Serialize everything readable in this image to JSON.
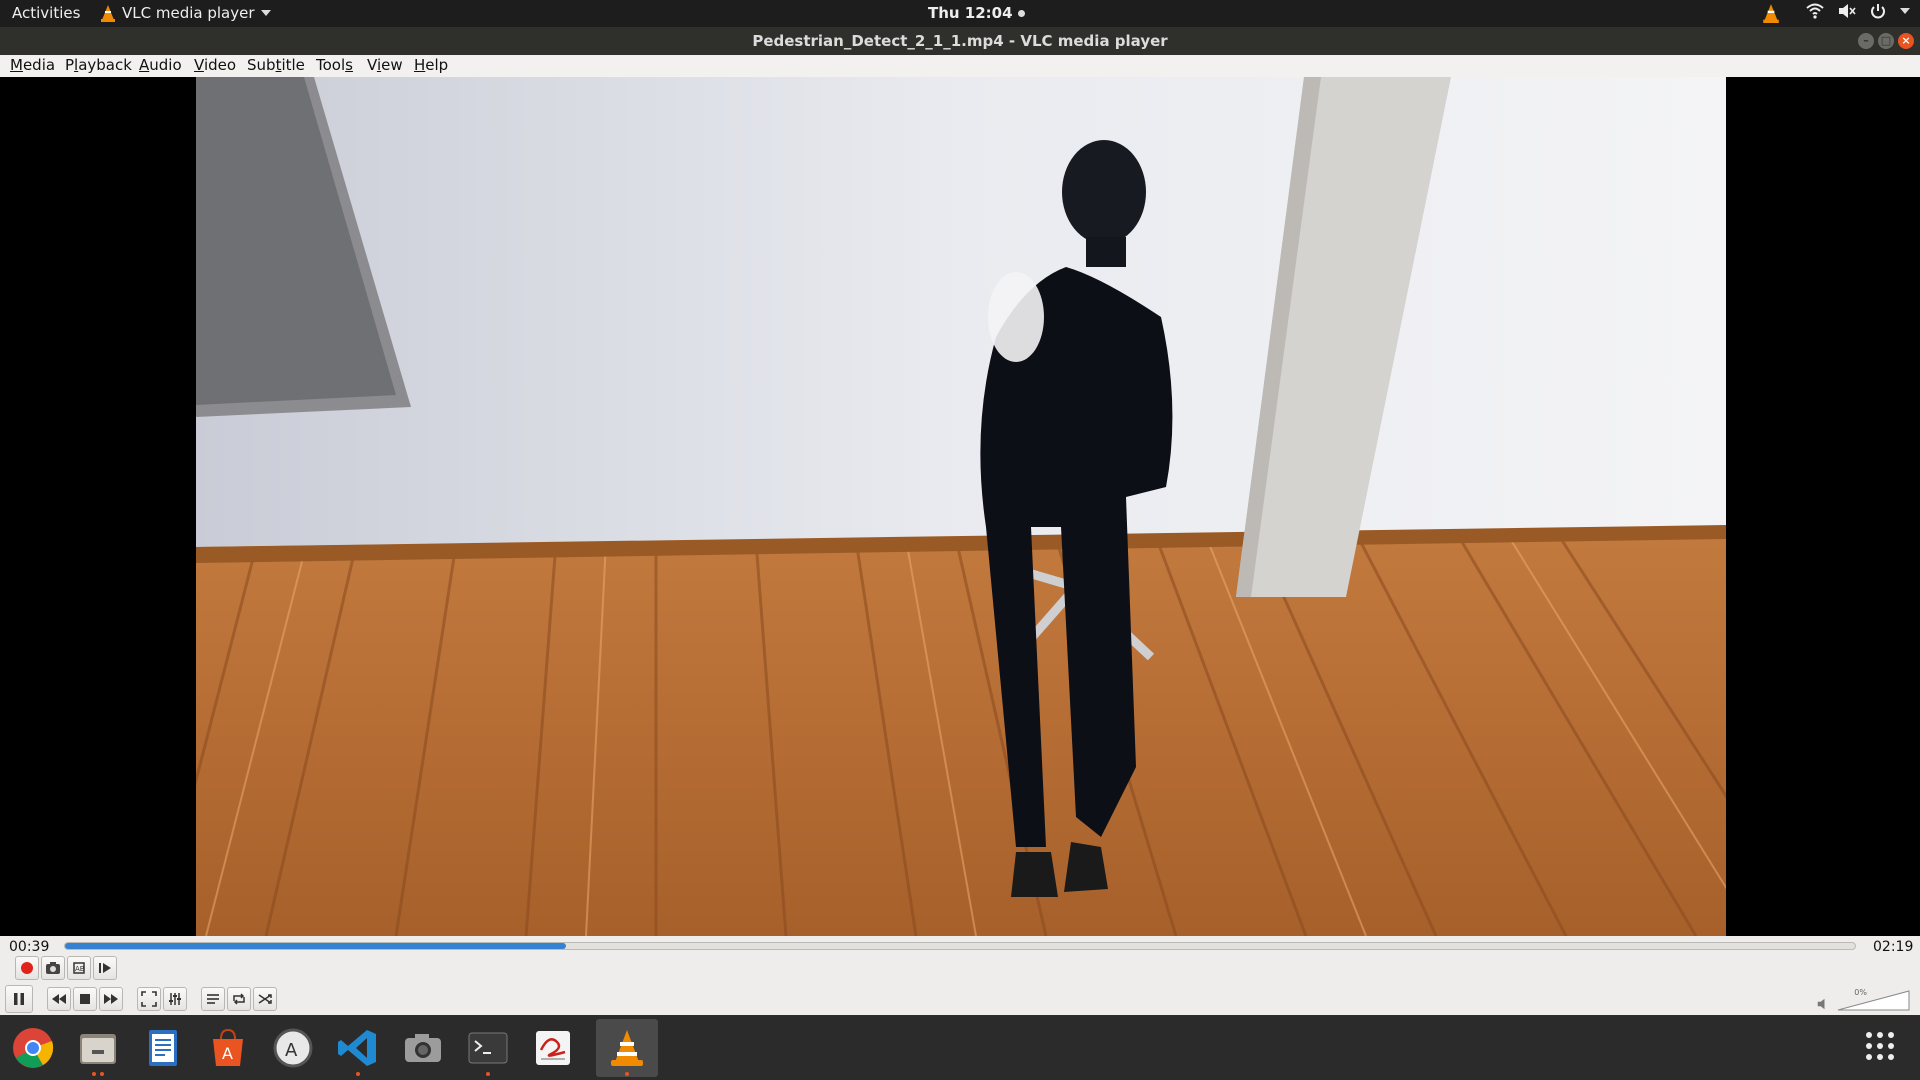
{
  "topbar": {
    "activities": "Activities",
    "app_name": "VLC media player",
    "clock": "Thu 12:04",
    "tray_icons": [
      "vlc-tray-icon",
      "wifi-icon",
      "volume-muted-icon",
      "power-icon"
    ]
  },
  "window": {
    "title": "Pedestrian_Detect_2_1_1.mp4 - VLC media player",
    "buttons": [
      "minimize",
      "maximize",
      "close"
    ]
  },
  "menubar": {
    "items": [
      {
        "label": "Media",
        "mnemonic": "M"
      },
      {
        "label": "Playback",
        "mnemonic": "l"
      },
      {
        "label": "Audio",
        "mnemonic": "A"
      },
      {
        "label": "Video",
        "mnemonic": "V"
      },
      {
        "label": "Subtitle",
        "mnemonic": "t"
      },
      {
        "label": "Tools",
        "mnemonic": "s"
      },
      {
        "label": "View",
        "mnemonic": "i"
      },
      {
        "label": "Help",
        "mnemonic": "H"
      }
    ]
  },
  "player": {
    "elapsed": "00:39",
    "total": "02:19",
    "progress_fraction": 0.28,
    "volume_percent": "0%",
    "colors": {
      "progress": "#3583d0",
      "record": "#e0221b"
    }
  },
  "dock": {
    "items": [
      {
        "name": "chrome",
        "running": false
      },
      {
        "name": "files",
        "running": true
      },
      {
        "name": "text-editor",
        "running": false
      },
      {
        "name": "software-center",
        "running": false
      },
      {
        "name": "software-updater",
        "running": false
      },
      {
        "name": "vscode",
        "running": true
      },
      {
        "name": "screenshot",
        "running": false
      },
      {
        "name": "terminal",
        "running": true
      },
      {
        "name": "document-viewer",
        "running": false
      },
      {
        "name": "vlc",
        "running": true
      }
    ],
    "colors": {
      "accent": "#e95420"
    }
  }
}
